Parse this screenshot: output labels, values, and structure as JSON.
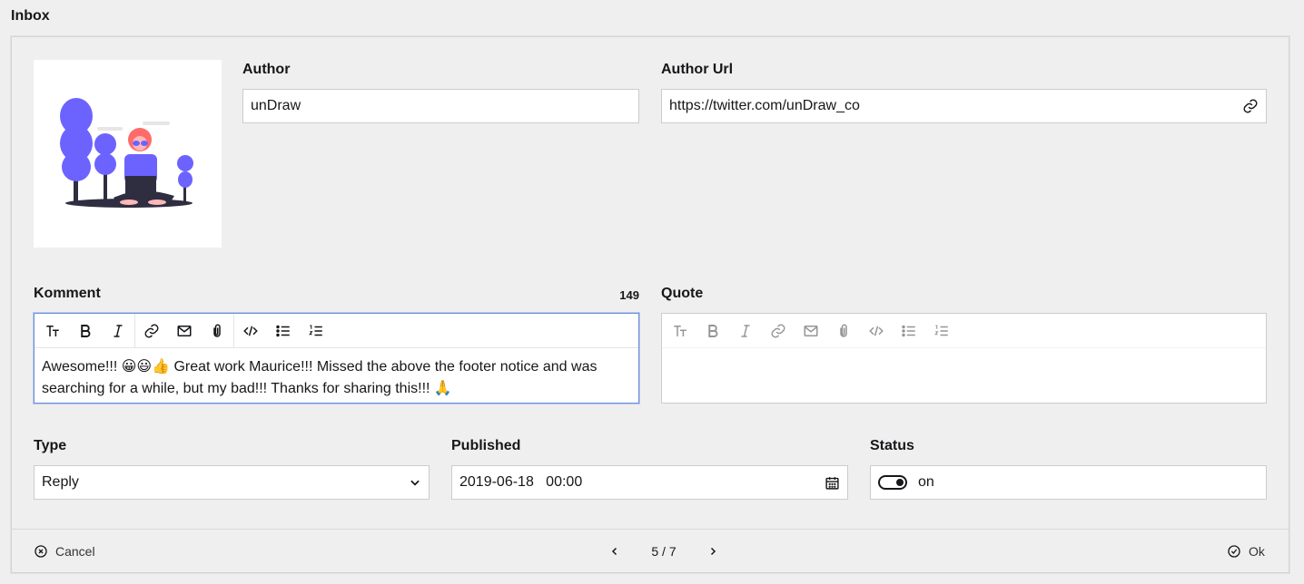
{
  "section": {
    "title": "Inbox"
  },
  "form": {
    "author": {
      "label": "Author",
      "value": "unDraw"
    },
    "author_url": {
      "label": "Author Url",
      "value": "https://twitter.com/unDraw_co",
      "icon": "link-icon"
    },
    "komment": {
      "label": "Komment",
      "counter": "149",
      "text": "Awesome!!! 😀😃👍 Great work Maurice!!! Missed the above the footer notice and was searching for a while, but my bad!!! Thanks for sharing this!!! 🙏"
    },
    "quote": {
      "label": "Quote",
      "text": ""
    },
    "type": {
      "label": "Type",
      "value": "Reply"
    },
    "published": {
      "label": "Published",
      "value": "2019-06-18   00:00"
    },
    "status": {
      "label": "Status",
      "value": "on"
    }
  },
  "toolbar_icons": [
    "headings-icon",
    "bold-icon",
    "italic-icon",
    "link-icon",
    "email-icon",
    "attachment-icon",
    "code-icon",
    "bullet-list-icon",
    "ordered-list-icon"
  ],
  "footer": {
    "cancel_label": "Cancel",
    "ok_label": "Ok",
    "pagination": "5 / 7"
  },
  "colors": {
    "background": "#efefef",
    "focus_border": "#6b8fd6",
    "text": "#16171a",
    "illustration_purple": "#6c63ff"
  }
}
